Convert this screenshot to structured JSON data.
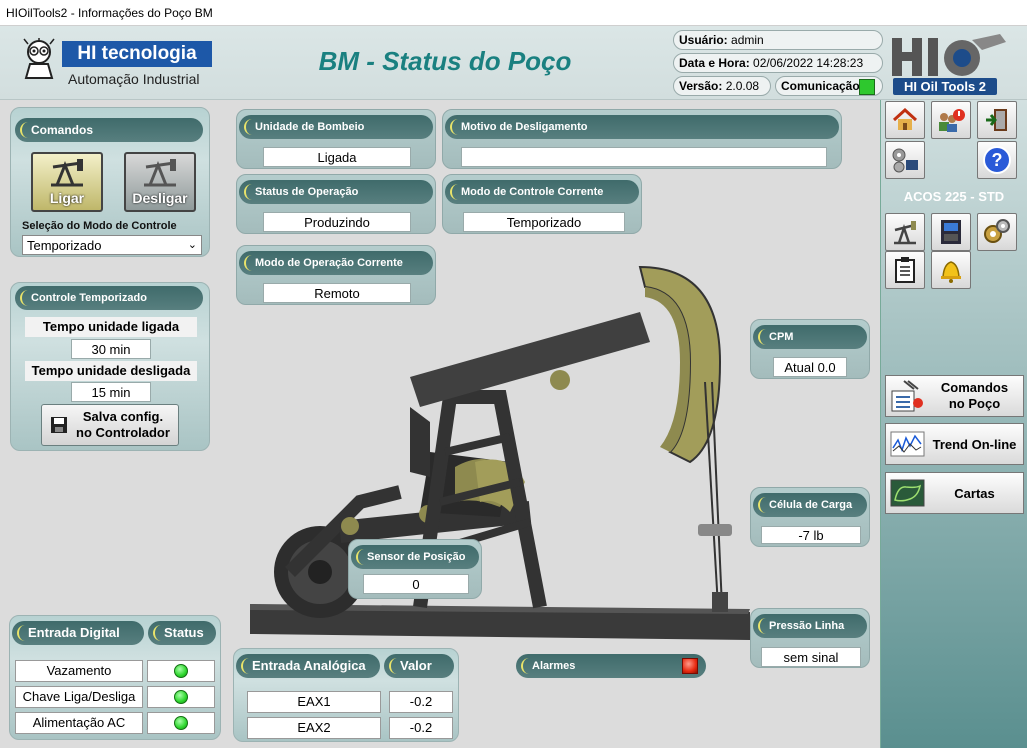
{
  "window": {
    "title": "HIOilTools2 - Informações do Poço BM"
  },
  "header": {
    "brand": "HI tecnologia",
    "brand_sub": "Automação Industrial",
    "page_title": "BM - Status do Poço",
    "user_label": "Usuário:",
    "user_value": "admin",
    "datetime_label": "Data e Hora:",
    "datetime_value": "02/06/2022 14:28:23",
    "version_label": "Versão:",
    "version_value": "2.0.08",
    "comm_label": "Comunicação:",
    "comm_color": "#2ec82e",
    "product_logo_text": "HI Oil Tools 2"
  },
  "commands": {
    "title": "Comandos",
    "on_label": "Ligar",
    "off_label": "Desligar",
    "mode_select_label": "Seleção do Modo de Controle",
    "mode_selected": "Temporizado"
  },
  "timer": {
    "title": "Controle Temporizado",
    "on_time_label": "Tempo unidade ligada",
    "on_time_value": "30 min",
    "off_time_label": "Tempo unidade desligada",
    "off_time_value": "15 min",
    "save_label_1": "Salva config.",
    "save_label_2": "no Controlador"
  },
  "status": {
    "pump_unit_label": "Unidade de Bombeio",
    "pump_unit_value": "Ligada",
    "shutdown_label": "Motivo de Desligamento",
    "shutdown_value": "",
    "op_status_label": "Status de Operação",
    "op_status_value": "Produzindo",
    "control_mode_label": "Modo de Controle Corrente",
    "control_mode_value": "Temporizado",
    "op_mode_label": "Modo de Operação Corrente",
    "op_mode_value": "Remoto"
  },
  "sensors": {
    "cpm_label": "CPM",
    "cpm_value": "Atual 0.0",
    "load_label": "Célula de Carga",
    "load_value": "-7 lb",
    "pressure_label": "Pressão Linha",
    "pressure_value": "sem sinal",
    "position_label": "Sensor de Posição",
    "position_value": "0",
    "alarms_label": "Alarmes",
    "alarm_color": "#e82a10"
  },
  "digital_inputs": {
    "title": "Entrada Digital",
    "status_header": "Status",
    "rows": [
      {
        "name": "Vazamento",
        "color": "#2cd62c"
      },
      {
        "name": "Chave Liga/Desliga",
        "color": "#2cd62c"
      },
      {
        "name": "Alimentação AC",
        "color": "#2cd62c"
      }
    ]
  },
  "analog_inputs": {
    "title": "Entrada Analógica",
    "value_header": "Valor",
    "rows": [
      {
        "name": "EAX1",
        "value": "-0.2"
      },
      {
        "name": "EAX2",
        "value": "-0.2"
      }
    ]
  },
  "sidebar": {
    "device_label": "ACOS 225 - STD",
    "top_icons": [
      "home-icon",
      "users-power-icon",
      "exit-door-icon",
      "gears-monitor-icon",
      "help-icon"
    ],
    "device_icons": [
      "pumpjack-icon",
      "controller-icon",
      "gears-icon",
      "clipboard-icon",
      "bell-icon"
    ],
    "help_glyph": "?",
    "well_commands_label_1": "Comandos",
    "well_commands_label_2": "no Poço",
    "trend_label": "Trend On-line",
    "charts_label": "Cartas"
  }
}
